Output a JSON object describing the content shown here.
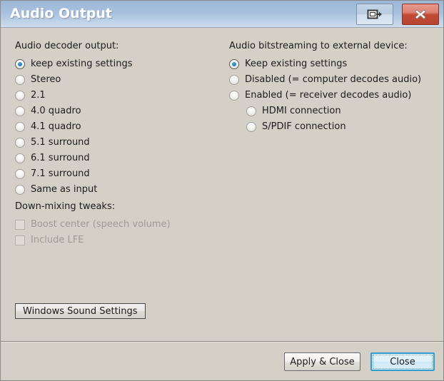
{
  "window": {
    "title": "Audio Output",
    "titlebar_buttons": [
      {
        "name": "minimize-to-tray-button",
        "icon": "restore-window-icon",
        "label": ""
      },
      {
        "name": "close-window-button",
        "icon": "close-x-icon",
        "label": ""
      }
    ]
  },
  "decoder": {
    "group_label": "Audio decoder output:",
    "options": [
      {
        "label": "keep existing settings",
        "checked": true
      },
      {
        "label": "Stereo",
        "checked": false
      },
      {
        "label": "2.1",
        "checked": false
      },
      {
        "label": "4.0 quadro",
        "checked": false
      },
      {
        "label": "4.1 quadro",
        "checked": false
      },
      {
        "label": "5.1 surround",
        "checked": false
      },
      {
        "label": "6.1 surround",
        "checked": false
      },
      {
        "label": "7.1 surround",
        "checked": false
      },
      {
        "label": "Same as input",
        "checked": false
      }
    ]
  },
  "downmix": {
    "group_label": "Down-mixing tweaks:",
    "options": [
      {
        "label": "Boost center (speech volume)",
        "checked": false,
        "disabled": true
      },
      {
        "label": "Include LFE",
        "checked": false,
        "disabled": true
      }
    ]
  },
  "bitstreaming": {
    "group_label": "Audio bitstreaming to external device:",
    "options": [
      {
        "label": "Keep existing settings",
        "checked": true,
        "sub": false
      },
      {
        "label": "Disabled (= computer decodes audio)",
        "checked": false,
        "sub": false
      },
      {
        "label": "Enabled  (= receiver decodes audio)",
        "checked": false,
        "sub": false
      },
      {
        "label": "HDMI connection",
        "checked": false,
        "sub": true
      },
      {
        "label": "S/PDIF connection",
        "checked": false,
        "sub": true
      }
    ]
  },
  "buttons": {
    "sound_settings": "Windows Sound Settings",
    "apply_close": "Apply & Close",
    "close": "Close"
  },
  "colors": {
    "dialog_background": "#d4d0c8",
    "titlebar_top": "#9cb7d7",
    "titlebar_bottom": "#cfdcec",
    "close_button_red": "#c14a35",
    "focus_blue": "#2f9bd3",
    "radio_dot_blue": "#1b7ab3",
    "disabled_text": "#9d9a94",
    "text": "#1c1c1c"
  }
}
